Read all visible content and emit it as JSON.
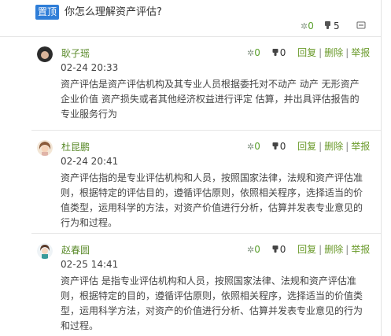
{
  "question": {
    "pin_badge": "置顶",
    "title": "你怎么理解资产评估?",
    "like_count": "0",
    "dislike_count": "5",
    "like_icon": "thumbs-up-icon",
    "dislike_icon": "thumbs-down-icon",
    "more_icon": "ellipsis-icon"
  },
  "comments": [
    {
      "author": "耿子瑶",
      "time": "02-24 20:33",
      "content": "资产评估是资产评估机构及其专业人员根据委托对不动产 动产 无形资产 企业价值 资产损失或者其他经济权益进行评定 估算，并出具评估报告的专业服务行为",
      "likes": "0",
      "dislikes": "0",
      "reply_label": "回复",
      "delete_label": "删除",
      "report_label": "举报",
      "separator": "|"
    },
    {
      "author": "杜昆鹏",
      "time": "02-24 20:41",
      "content": "资产评估指的是专业评估机构和人员，按照国家法律，法规和资产评估准则，根据特定的评估目的，遵循评估原则，依照相关程序，选择适当的价值类型，运用科学的方法，对资产价值进行分析，估算并发表专业意见的行为和过程。",
      "likes": "0",
      "dislikes": "0",
      "reply_label": "回复",
      "delete_label": "删除",
      "report_label": "举报",
      "separator": "|"
    },
    {
      "author": "赵春圆",
      "time": "02-25 14:41",
      "content": "资产评估 是指专业评估机构和人员，按照国家法律、法规和资产评估准则，根据特定的目的，遵循评估原则，依照相关程序，选择适当的价值类型，运用科学方法，对资产的价值进行分析、估算并发表专业意见的行为和过程。",
      "likes": "0",
      "dislikes": "0",
      "reply_label": "回复",
      "delete_label": "删除",
      "report_label": "举报",
      "separator": "|"
    }
  ],
  "colors": {
    "accent_green": "#6a9a2a",
    "badge_blue": "#2f7ed8"
  }
}
